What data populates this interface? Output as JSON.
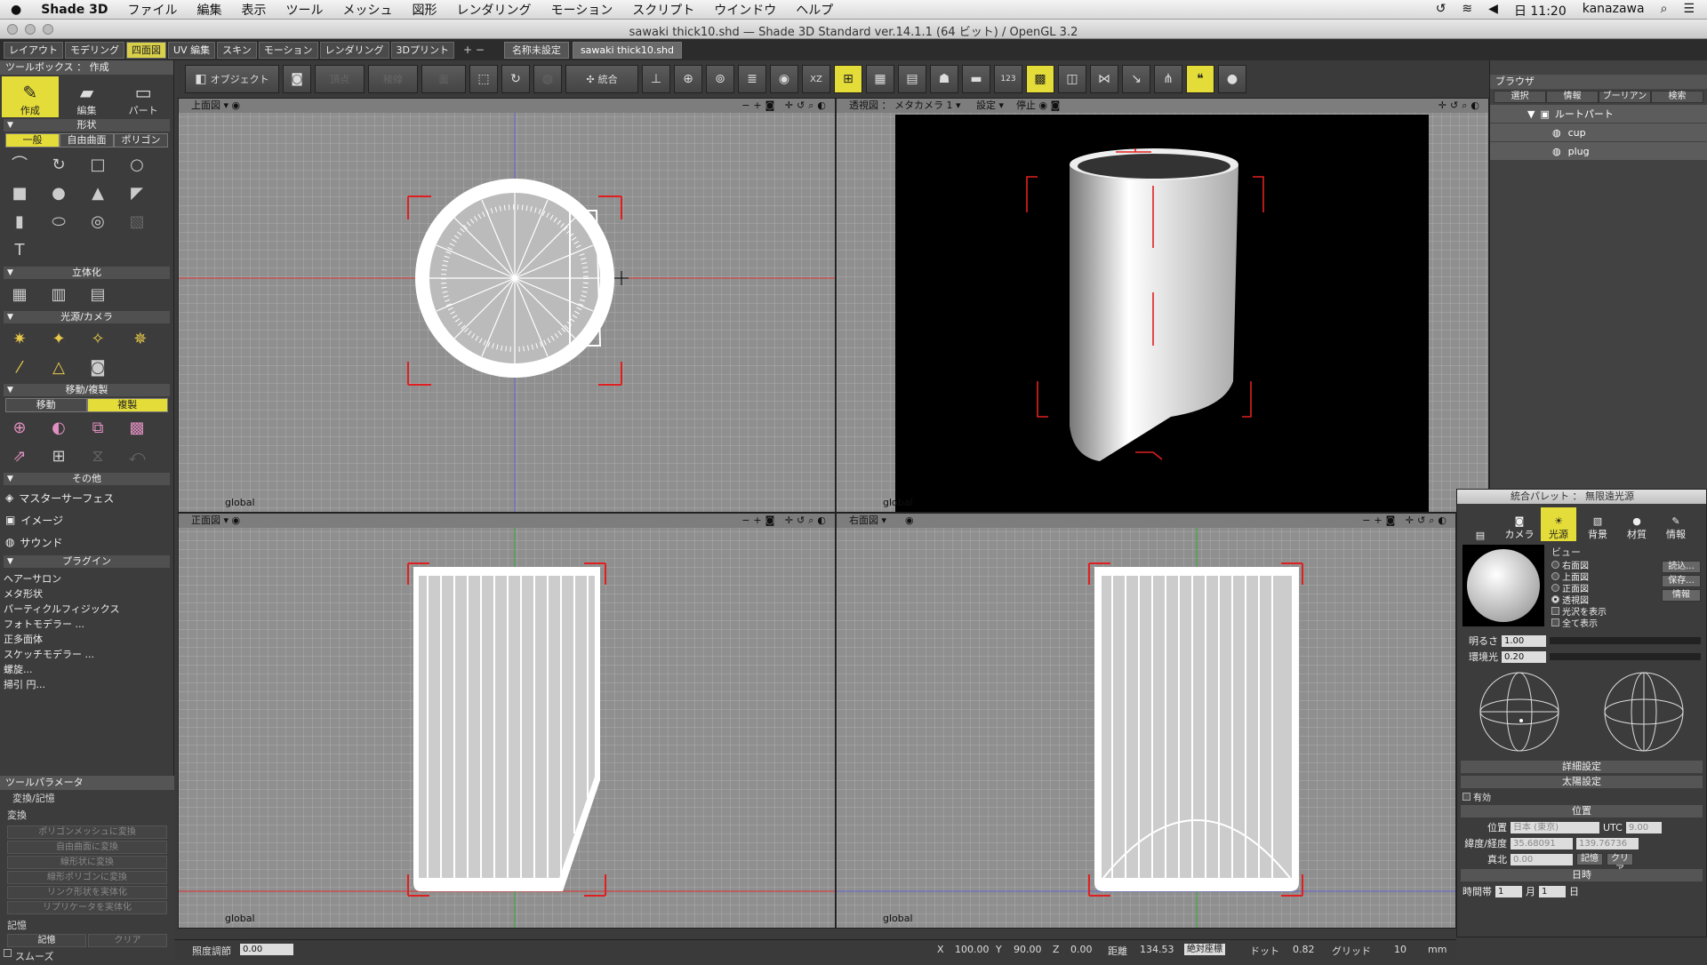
{
  "menubar": {
    "app": "Shade 3D",
    "items": [
      "ファイル",
      "編集",
      "表示",
      "ツール",
      "メッシュ",
      "図形",
      "レンダリング",
      "モーション",
      "スクリプト",
      "ウインドウ",
      "ヘルプ"
    ],
    "clock": "日 11:20",
    "user": "kanazawa"
  },
  "window": {
    "title": "sawaki thick10.shd — Shade 3D Standard ver.14.1.1 (64 ビット) / OpenGL 3.2"
  },
  "modes": [
    "レイアウト",
    "モデリング",
    "四面図",
    "UV 編集",
    "スキン",
    "モーション",
    "レンダリング",
    "3Dプリント"
  ],
  "files": [
    "名称未設定",
    "sawaki thick10.shd"
  ],
  "toolbox": {
    "title": "ツールボックス ： 作成",
    "main": [
      "作成",
      "編集",
      "パート"
    ],
    "shape": "形状",
    "shape_tabs": [
      "一般",
      "自由曲面",
      "ポリゴン"
    ],
    "solid": "立体化",
    "light": "光源/カメラ",
    "move": "移動/複製",
    "move_tabs": [
      "移動",
      "複製"
    ],
    "other": "その他",
    "others": [
      "マスターサーフェス",
      "イメージ",
      "サウンド"
    ],
    "plugin": "プラグイン",
    "plugins": [
      "ヘアーサロン",
      "メタ形状",
      "パーティクルフィジックス",
      "フォトモデラー ...",
      "正多面体",
      "スケッチモデラー ...",
      "螺旋...",
      "掃引 円..."
    ]
  },
  "toolparam": {
    "title": "ツールパラメータ",
    "sub": "変換/記憶",
    "conv": "変換",
    "conv_btns": [
      "ポリゴンメッシュに変換",
      "自由曲面に変換",
      "線形状に変換",
      "線形ポリゴンに変換",
      "リンク形状を実体化",
      "リプリケータを実体化"
    ],
    "mem": "記憶",
    "mem_btns": [
      "記憶",
      "クリア"
    ],
    "smooth": "スムーズ"
  },
  "toolbar": {
    "object": "オブジェクト",
    "vertex": "頂点",
    "edge": "稜線",
    "face": "面",
    "integrate": "統合"
  },
  "viewports": {
    "top": "上面図",
    "persp": "透視図 ： メタカメラ 1",
    "settings": "設定",
    "stop": "停止",
    "front": "正面図",
    "right": "右面図",
    "global": "global"
  },
  "browser": {
    "title": "ブラウザ",
    "tabs": [
      "選択",
      "情報",
      "ブーリアン",
      "検索"
    ],
    "tree": [
      "ルートパート",
      "cup",
      "plug"
    ]
  },
  "palette": {
    "title": "統合パレット ： 無限遠光源",
    "tabs": [
      "カメラ",
      "光源",
      "背景",
      "材質",
      "情報"
    ],
    "view": "ビュー",
    "view_opts": [
      "右面図",
      "上面図",
      "正面図",
      "透視図",
      "光沢を表示",
      "全て表示"
    ],
    "btns": [
      "読込...",
      "保存...",
      "情報"
    ],
    "brightness_label": "明るさ",
    "brightness": "1.00",
    "ambient_label": "環境光",
    "ambient": "0.20",
    "detail": "詳細設定",
    "sun": "太陽設定",
    "enabled": "有効",
    "position": "位置",
    "location": "日本 (東京)",
    "utc_label": "UTC",
    "utc": "9.00",
    "latlon_label": "緯度/経度",
    "lat": "35.68091",
    "lon": "139.76736",
    "north_label": "真北",
    "north": "0.00",
    "memo": "記憶",
    "clear": "クリア",
    "date": "日時",
    "time": "時間帯",
    "month": "月",
    "day": "日"
  },
  "status": {
    "illum_label": "照度調節",
    "illum": "0.00",
    "x_label": "X",
    "x": "100.00",
    "y_label": "Y",
    "y": "90.00",
    "z_label": "Z",
    "z": "0.00",
    "dist_label": "距離",
    "dist": "134.53",
    "abs": "絶対座標",
    "dot_label": "ドット",
    "dot": "0.82",
    "grid_label": "グリッド",
    "grid": "10",
    "unit": "mm"
  },
  "colors": {
    "accent": "#e4dc38",
    "bbox": "#e02020",
    "viewport": "#8f8f8f"
  }
}
